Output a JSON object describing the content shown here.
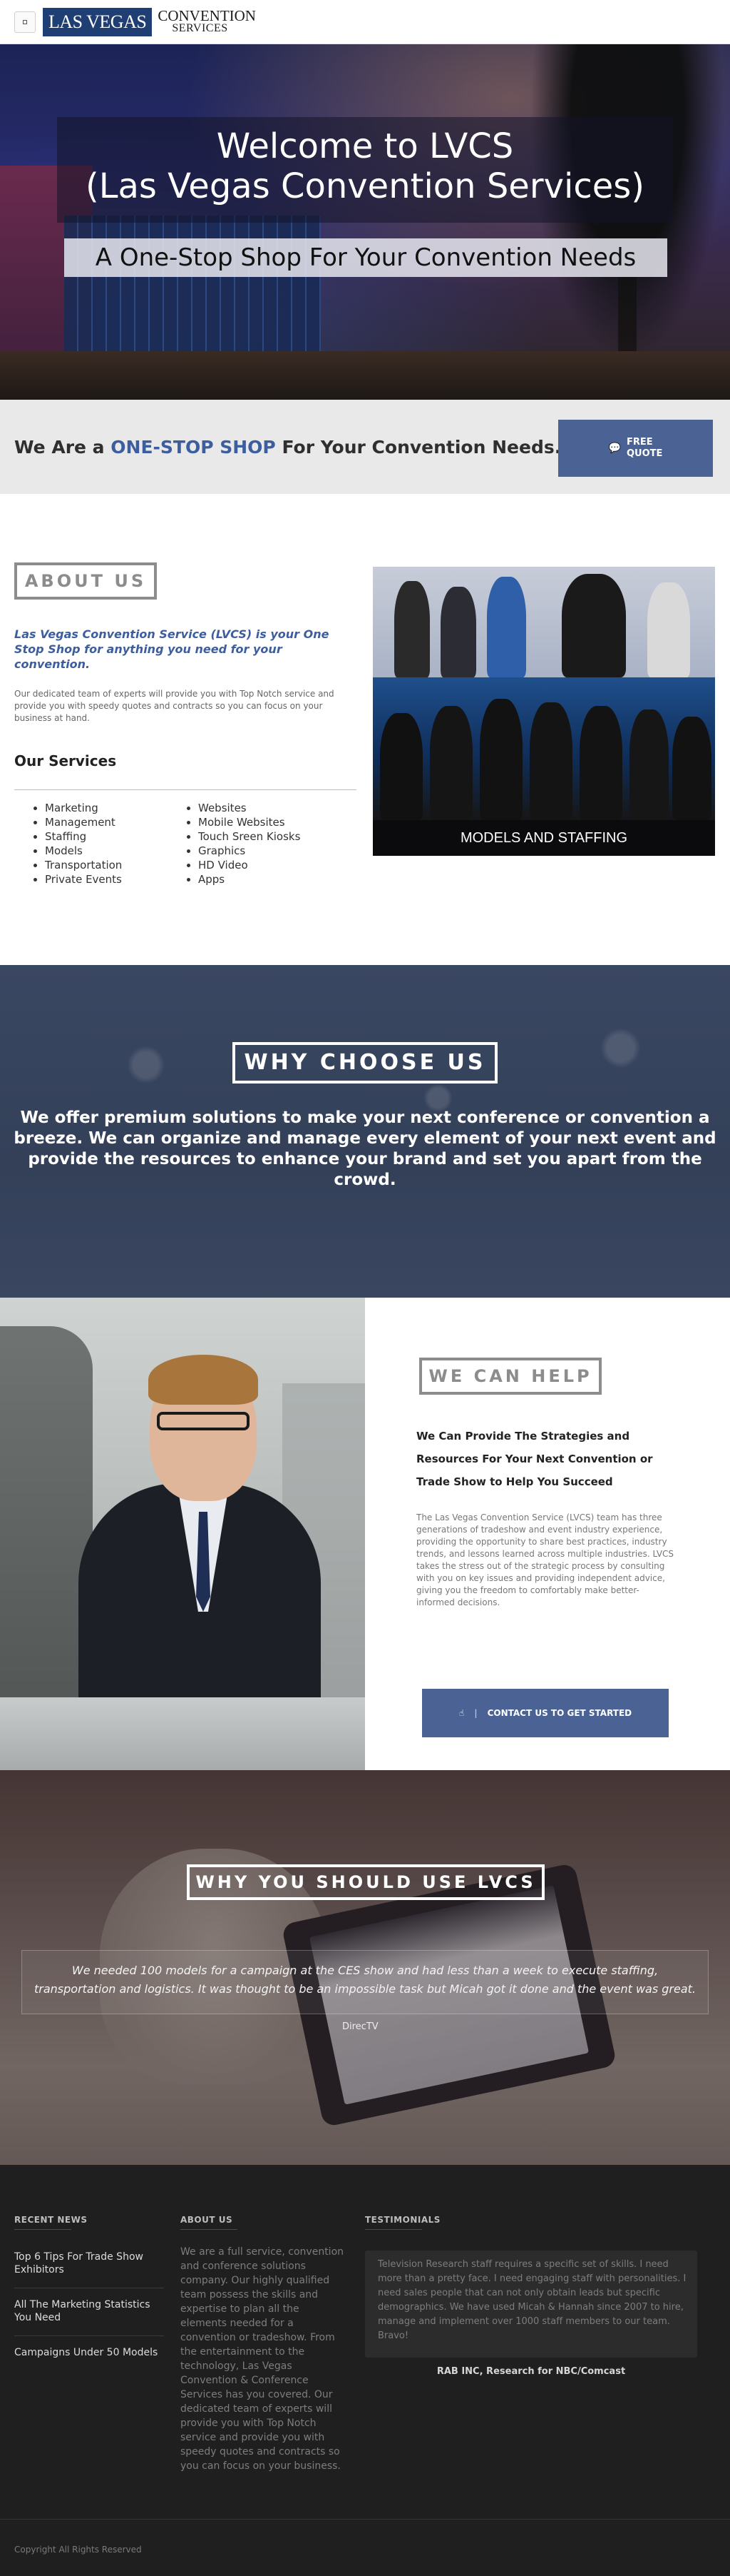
{
  "nav": {
    "logo_box": "LAS VEGAS",
    "logo_line1": "CONVENTION",
    "logo_line2": "SERVICES"
  },
  "hero": {
    "title": "Welcome to LVCS\n(Las Vegas Convention Services)",
    "subtitle": "A One-Stop Shop For Your Convention Needs"
  },
  "banner": {
    "text_before": "We Are a ",
    "text_highlight": "ONE-STOP SHOP",
    "text_after": " For Your Convention Needs.",
    "quote_button": "FREE\nQUOTE",
    "quote_icon": "comment-icon"
  },
  "about": {
    "title": "ABOUT US",
    "lead": "Las Vegas Convention Service (LVCS) is your One Stop Shop for anything you need for your convention.",
    "body": "Our dedicated team of experts will provide you with Top Notch service and provide you with speedy quotes and contracts so you can focus on your business at hand.",
    "services_title": "Our Services",
    "services_col1": [
      "Marketing",
      "Management",
      "Staffing",
      "Models",
      "Transportation",
      "Private Events"
    ],
    "services_col2": [
      "Websites",
      "Mobile Websites",
      "Touch Sreen Kiosks",
      "Graphics",
      "HD Video",
      "Apps"
    ],
    "photo_caption": "MODELS AND STAFFING"
  },
  "why": {
    "title": "WHY CHOOSE US",
    "text": "We offer premium solutions to make your next conference or convention a breeze. We can organize and manage every element of your next event and provide the resources to enhance your brand and set you apart from the crowd."
  },
  "help": {
    "title": "WE CAN HELP",
    "lead": "We Can Provide The Strategies and Resources For Your Next Convention or Trade Show to Help You Succeed",
    "body": "The Las Vegas Convention Service (LVCS) team has three generations of tradeshow and event industry experience, providing the opportunity to share best practices, industry trends, and lessons learned across multiple industries. LVCS takes the stress out of the strategic process by consulting with you on key issues and providing independent advice, giving you the freedom to comfortably make better-informed decisions.",
    "button": "CONTACT US TO GET STARTED",
    "button_icon": "thumbs-up-icon"
  },
  "why2": {
    "title": "WHY YOU SHOULD USE LVCS",
    "quote": "We needed 100 models for a campaign at the CES show and had less than a week to execute staffing, transportation and logistics. It was thought to be an impossible task but Micah got it done and the event was great.",
    "brand": "DirecTV"
  },
  "footer": {
    "news_title": "RECENT NEWS",
    "news": [
      "Top 6 Tips For Trade Show Exhibitors",
      "All The Marketing Statistics You Need",
      "Campaigns Under 50 Models"
    ],
    "about_title": "ABOUT US",
    "about_text": "We are a full service, convention and conference solutions company. Our highly qualified team possess the skills and expertise to plan all the elements needed for a convention or tradeshow. From the entertainment to the technology, Las Vegas Convention & Conference Services has you covered. Our dedicated team of experts will provide you with Top Notch service and provide you with speedy quotes and contracts so you can focus on your business.",
    "testimonials_title": "TESTIMONIALS",
    "testimonial": "Television Research staff requires a specific set of skills. I need more than a pretty face. I need engaging staff with personalities. I need sales people that can not only obtain leads but specific demographics. We have used Micah & Hannah since 2007 to hire, manage and implement over 1000 staff members to our team. Bravo!",
    "testimonial_author": "RAB INC, Research for NBC/Comcast",
    "copyright": "Copyright All Rights Reserved"
  },
  "colors": {
    "accent": "#4a6394",
    "highlight": "#3d5e9e",
    "logo_blue": "#1f3f74",
    "footer_bg": "#1f1f1f"
  }
}
